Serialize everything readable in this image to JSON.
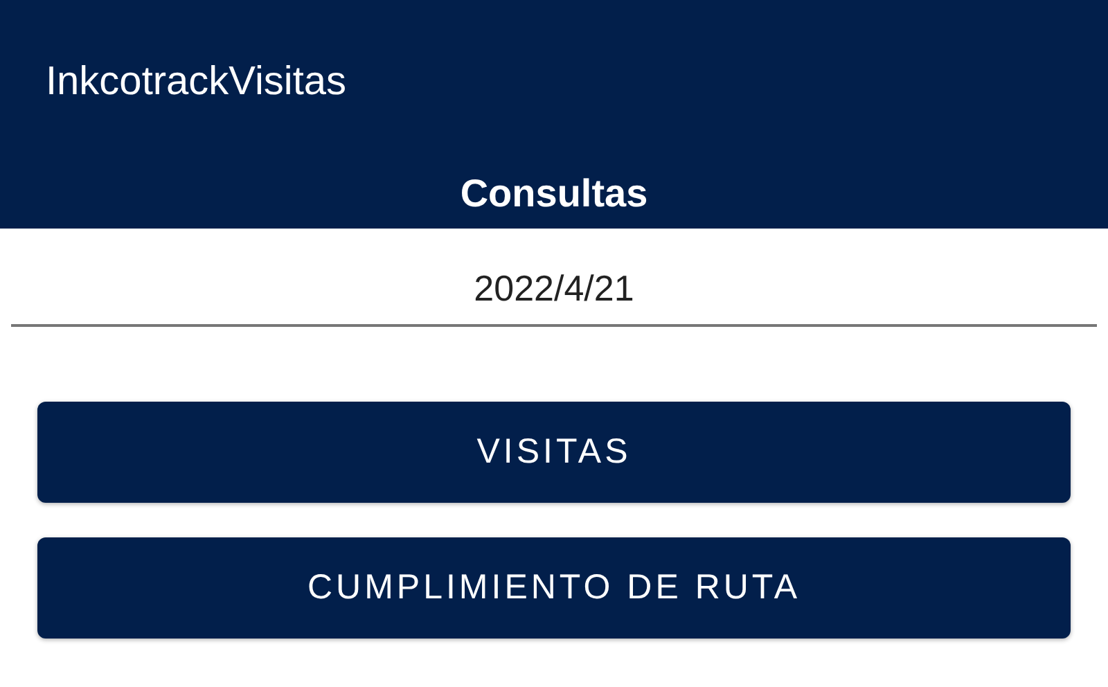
{
  "app_bar": {
    "title": "InkcotrackVisitas",
    "subtitle": "Consultas"
  },
  "date_field": {
    "value": "2022/4/21"
  },
  "buttons": [
    {
      "label": "VISITAS"
    },
    {
      "label": "CUMPLIMIENTO DE RUTA"
    }
  ]
}
